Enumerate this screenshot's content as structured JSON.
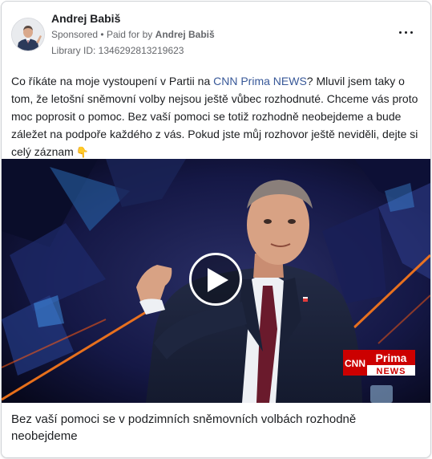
{
  "advertiser": {
    "name": "Andrej Babiš",
    "sponsored_label": "Sponsored",
    "bullet": "•",
    "paid_for_label": "Paid for by",
    "paid_for_name": "Andrej Babiš",
    "library_id": "Library ID: 1346292813219623",
    "more_icon": "more-horizontal-icon"
  },
  "post": {
    "text_before_link": "Co říkáte na moje vystoupení v Partii na ",
    "link_text": "CNN Prima NEWS",
    "text_after_link": "? Mluvil jsem taky o tom, že letošní sněmovní volby nejsou ještě vůbec rozhodnuté. Chceme vás proto moc poprosit o pomoc. Bez vaší pomoci se totiž rozhodně neobejdeme a bude záležet na podpoře každého z vás. Pokud jste můj rozhovor ještě neviděli, dejte si celý záznam",
    "emoji": "👇",
    "link_color": "#385898"
  },
  "video": {
    "play_icon": "play-icon",
    "logo_cnn": "CNN",
    "logo_prima": "Prima",
    "logo_news": "NEWS"
  },
  "caption": {
    "text": "Bez vaší pomoci se v podzimních sněmovních volbách rozhodně neobejdeme"
  }
}
